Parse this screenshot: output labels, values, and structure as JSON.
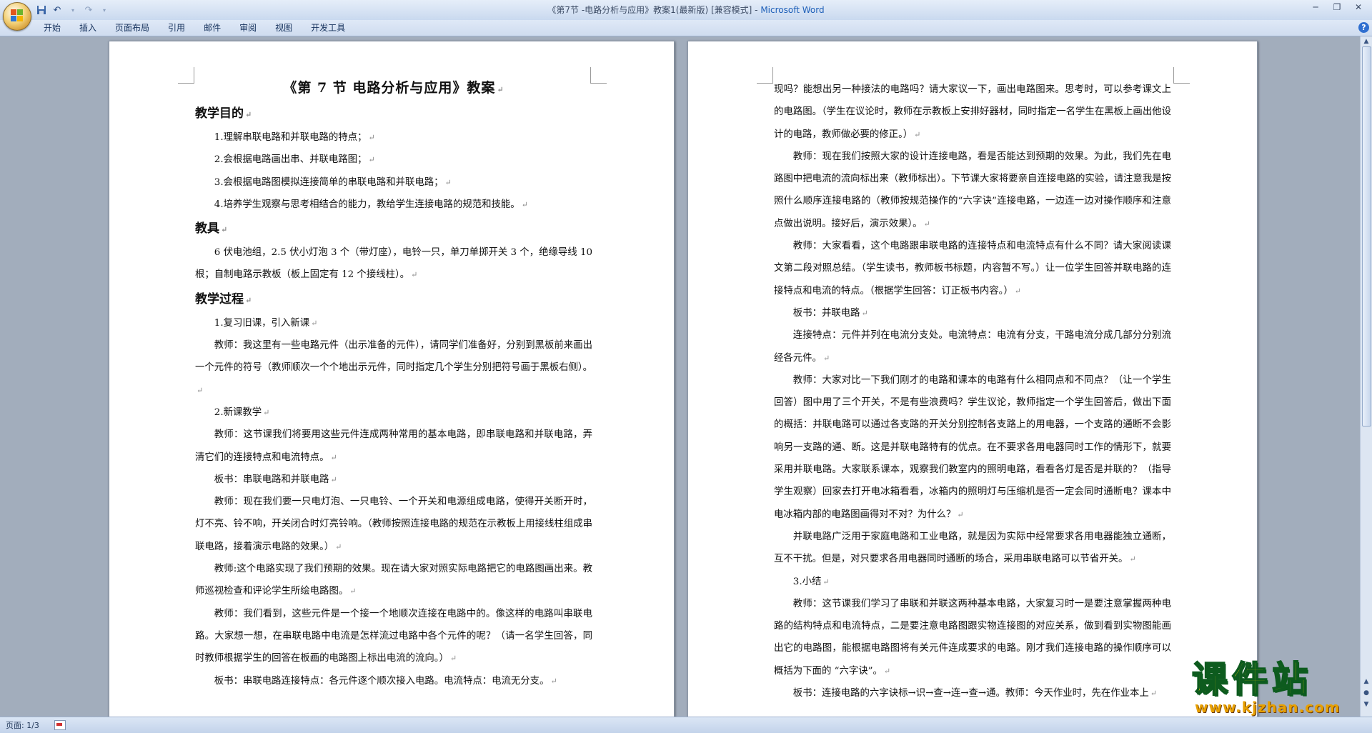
{
  "window": {
    "title": "《第7节 -电路分析与应用》教案1(最新版) [兼容模式] - ",
    "app_name": "Microsoft Word"
  },
  "quick_access": {
    "icons": [
      "save-icon",
      "undo-icon",
      "redo-icon",
      "customize-dropdown-icon"
    ]
  },
  "ribbon": {
    "tabs": [
      "开始",
      "插入",
      "页面布局",
      "引用",
      "邮件",
      "审阅",
      "视图",
      "开发工具"
    ]
  },
  "page1": {
    "title": "《第 7 节  电路分析与应用》教案",
    "blocks": [
      {
        "type": "heading",
        "text": "教学目的"
      },
      {
        "type": "para",
        "text": "1.理解串联电路和并联电路的特点；"
      },
      {
        "type": "para",
        "text": "2.会根据电路画出串、并联电路图；"
      },
      {
        "type": "para",
        "text": "3.会根据电路图模拟连接简单的串联电路和并联电路；"
      },
      {
        "type": "para",
        "text": "4.培养学生观察与思考相结合的能力，教给学生连接电路的规范和技能。"
      },
      {
        "type": "heading",
        "text": "教具"
      },
      {
        "type": "para",
        "text": "6 伏电池组，2.5 伏小灯泡 3 个（带灯座），电铃一只，单刀单掷开关 3 个，绝缘导线 10 根；自制电路示教板（板上固定有 12 个接线柱）。"
      },
      {
        "type": "heading",
        "text": "教学过程"
      },
      {
        "type": "para",
        "text": "1.复习旧课，引入新课"
      },
      {
        "type": "para",
        "text": "教师：我这里有一些电路元件（出示准备的元件），请同学们准备好，分别到黑板前来画出一个元件的符号（教师顺次一个个地出示元件，同时指定几个学生分别把符号画于黑板右侧）。"
      },
      {
        "type": "para",
        "text": "2.新课教学"
      },
      {
        "type": "para",
        "text": "教师：这节课我们将要用这些元件连成两种常用的基本电路，即串联电路和并联电路，弄清它们的连接特点和电流特点。"
      },
      {
        "type": "para",
        "text": "板书：串联电路和并联电路"
      },
      {
        "type": "para",
        "text": "教师：现在我们要一只电灯泡、一只电铃、一个开关和电源组成电路，使得开关断开时，灯不亮、铃不响，开关闭合时灯亮铃响。（教师按照连接电路的规范在示教板上用接线柱组成串联电路，接着演示电路的效果。）"
      },
      {
        "type": "para",
        "text": "教师:这个电路实现了我们预期的效果。现在请大家对照实际电路把它的电路图画出来。教师巡视检查和评论学生所绘电路图。"
      },
      {
        "type": "para",
        "text": "教师：我们看到，这些元件是一个接一个地顺次连接在电路中的。像这样的电路叫串联电路。大家想一想，在串联电路中电流是怎样流过电路中各个元件的呢？（请一名学生回答，同时教师根据学生的回答在板画的电路图上标出电流的流向。）"
      },
      {
        "type": "para",
        "text": "板书：串联电路连接特点：各元件逐个顺次接入电路。电流特点：电流无分支。"
      }
    ]
  },
  "page2": {
    "blocks": [
      {
        "type": "para",
        "indent": false,
        "text": "现吗？能想出另一种接法的电路吗？请大家议一下，画出电路图来。思考时，可以参考课文上的电路图。（学生在议论时，教师在示教板上安排好器材，同时指定一名学生在黑板上画出他设计的电路，教师做必要的修正。）"
      },
      {
        "type": "para",
        "text": "教师：现在我们按照大家的设计连接电路，看是否能达到预期的效果。为此，我们先在电路图中把电流的流向标出来（教师标出）。下节课大家将要亲自连接电路的实验，请注意我是按照什么顺序连接电路的（教师按规范操作的“六字诀”连接电路，一边连一边对操作顺序和注意点做出说明。接好后，演示效果）。"
      },
      {
        "type": "para",
        "text": "教师：大家看看，这个电路跟串联电路的连接特点和电流特点有什么不同？请大家阅读课文第二段对照总结。（学生读书，教师板书标题，内容暂不写。）让一位学生回答并联电路的连接特点和电流的特点。（根据学生回答：订正板书内容。）"
      },
      {
        "type": "para",
        "text": "板书：并联电路"
      },
      {
        "type": "para",
        "text": "连接特点：元件并列在电流分支处。电流特点：电流有分支，干路电流分成几部分分别流经各元件。"
      },
      {
        "type": "para",
        "text": "教师：大家对比一下我们刚才的电路和课本的电路有什么相同点和不同点？（让一个学生回答）图中用了三个开关，不是有些浪费吗？学生议论，教师指定一个学生回答后，做出下面的概括：并联电路可以通过各支路的开关分别控制各支路上的用电器，一个支路的通断不会影响另一支路的通、断。这是并联电路特有的优点。在不要求各用电器同时工作的情形下，就要采用并联电路。大家联系课本，观察我们教室内的照明电路，看看各灯是否是并联的？（指导学生观察）回家去打开电冰箱看看，冰箱内的照明灯与压缩机是否一定会同时通断电？课本中电冰箱内部的电路图画得对不对？为什么？"
      },
      {
        "type": "para",
        "text": "并联电路广泛用于家庭电路和工业电路，就是因为实际中经常要求各用电器能独立通断，互不干扰。但是，对只要求各用电器同时通断的场合，采用串联电路可以节省开关。"
      },
      {
        "type": "para",
        "text": "3.小结"
      },
      {
        "type": "para",
        "text": "教师：这节课我们学习了串联和并联这两种基本电路，大家复习时一是要注意掌握两种电路的结构特点和电流特点，二是要注意电路图跟实物连接图的对应关系，做到看到实物图能画出它的电路图，能根据电路图将有关元件连成要求的电路。刚才我们连接电路的操作顺序可以概括为下面的 “六字诀”。"
      },
      {
        "type": "para",
        "text": "板书：连接电路的六字诀标→识→查→连→查→通。教师：今天作业时，先在作业本上"
      }
    ]
  },
  "status": {
    "page_label": "页面: 1/3"
  },
  "watermark": {
    "title": "课件站",
    "url": "www.kjzhan.com"
  }
}
